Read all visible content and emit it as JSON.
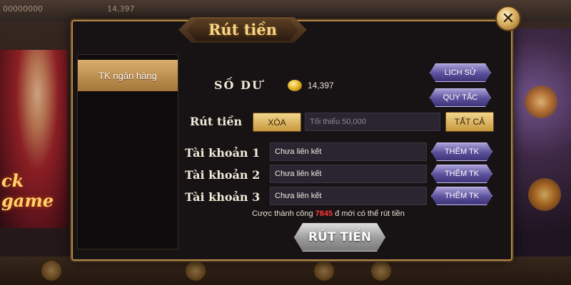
{
  "background": {
    "top_text_left": "00000000",
    "top_text_mid": "14,397",
    "promo_text": "ck game"
  },
  "modal": {
    "title": "Rút tiền",
    "close_symbol": "✕"
  },
  "sidebar": {
    "items": [
      {
        "label": "TK ngân hàng",
        "selected": true
      }
    ]
  },
  "balance": {
    "label": "SỐ DƯ",
    "value": "14,397",
    "icon": "gold-coin-icon"
  },
  "actions": {
    "history_label": "LỊCH SỬ",
    "rules_label": "QUY TẮC"
  },
  "withdraw": {
    "label": "Rút tiền",
    "clear_label": "XÓA",
    "amount_placeholder": "Tối thiểu 50,000",
    "all_label": "TẤT CẢ"
  },
  "accounts": [
    {
      "label": "Tài khoản 1",
      "value": "Chưa liên kết",
      "add_label": "THÊM TK"
    },
    {
      "label": "Tài khoản 2",
      "value": "Chưa liên kết",
      "add_label": "THÊM TK"
    },
    {
      "label": "Tài khoản 3",
      "value": "Chưa liên kết",
      "add_label": "THÊM TK"
    }
  ],
  "notice": {
    "prefix": "Cược thành công",
    "amount": "7845",
    "suffix": "đ mới có thể rút tiền"
  },
  "submit": {
    "label": "RÚT TIỀN"
  },
  "colors": {
    "gold_accent": "#b58a46",
    "purple_button": "#5a4f9a",
    "notice_red": "#ff3a3a"
  }
}
